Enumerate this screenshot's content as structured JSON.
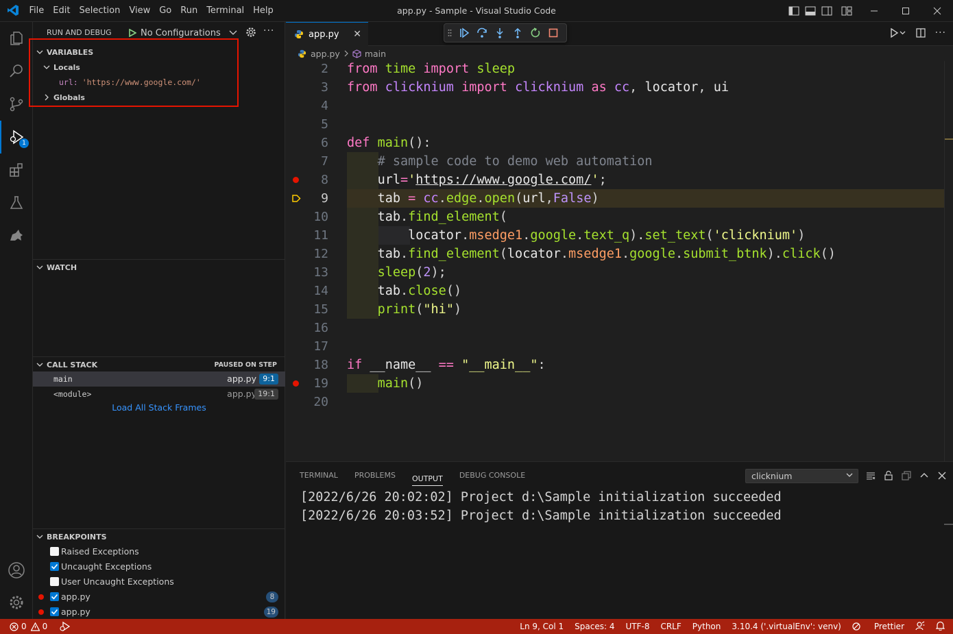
{
  "titlebar": {
    "menu": [
      "File",
      "Edit",
      "Selection",
      "View",
      "Go",
      "Run",
      "Terminal",
      "Help"
    ],
    "title": "app.py - Sample - Visual Studio Code"
  },
  "activitybar": {
    "debug_badge": "1"
  },
  "sidebar": {
    "title": "RUN AND DEBUG",
    "config": "No Configurations",
    "variables": {
      "header": "VARIABLES",
      "locals_label": "Locals",
      "url_name": "url:",
      "url_value": "'https://www.google.com/'",
      "globals_label": "Globals"
    },
    "watch": {
      "header": "WATCH"
    },
    "callstack": {
      "header": "CALL STACK",
      "status": "PAUSED ON STEP",
      "frames": [
        {
          "name": "main",
          "file": "app.py",
          "pos": "9:1"
        },
        {
          "name": "<module>",
          "file": "app.py",
          "pos": "19:1"
        }
      ],
      "load_all": "Load All Stack Frames"
    },
    "breakpoints": {
      "header": "BREAKPOINTS",
      "items": [
        {
          "label": "Raised Exceptions"
        },
        {
          "label": "Uncaught Exceptions"
        },
        {
          "label": "User Uncaught Exceptions"
        },
        {
          "label": "app.py",
          "line": "8"
        },
        {
          "label": "app.py",
          "line": "19"
        }
      ]
    }
  },
  "editor": {
    "tab": "app.py",
    "breadcrumb": {
      "file": "app.py",
      "symbol": "main"
    },
    "lines": [
      "2",
      "3",
      "4",
      "5",
      "6",
      "7",
      "8",
      "9",
      "10",
      "11",
      "12",
      "13",
      "14",
      "15",
      "16",
      "17",
      "18",
      "19",
      "20"
    ]
  },
  "panel": {
    "tabs": [
      "TERMINAL",
      "PROBLEMS",
      "OUTPUT",
      "DEBUG CONSOLE"
    ],
    "selected_channel": "clicknium",
    "output_lines": [
      "[2022/6/26 20:02:02] Project d:\\Sample initialization succeeded",
      "[2022/6/26 20:03:52] Project d:\\Sample initialization succeeded"
    ]
  },
  "statusbar": {
    "errors": "0",
    "warnings": "0",
    "position": "Ln 9, Col 1",
    "spaces": "Spaces: 4",
    "encoding": "UTF-8",
    "eol": "CRLF",
    "language": "Python",
    "interpreter": "3.10.4 ('.virtualEnv': venv)",
    "prettier": "Prettier"
  },
  "colors": {
    "statusbar_debug": "#a7210f",
    "accent": "#0078d4",
    "breakpoint": "#e51400",
    "highlight_box": "#e51400"
  }
}
